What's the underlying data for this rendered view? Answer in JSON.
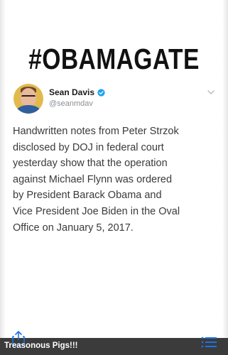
{
  "headline": {
    "hashtag": "#OBAMAGATE"
  },
  "tweet": {
    "display_name": "Sean Davis",
    "handle": "@seanmdav",
    "body": "Handwritten notes from Peter Strzok\ndisclosed by DOJ in federal court\nyesterday show that the operation\nagainst Michael Flynn was ordered\nby President Barack Obama and\nVice President Joe Biden in the Oval\nOffice on January 5, 2017.",
    "icons": {
      "verified": "verified-badge-icon",
      "more": "chevron-down-icon"
    }
  },
  "caption": {
    "text": "Treasonous Pigs!!!"
  },
  "toolbar": {
    "share_icon": "share-icon",
    "list_icon": "list-icon"
  },
  "colors": {
    "verified_blue": "#1da1f2",
    "caption_bg": "#3b3b3b",
    "list_icon_blue": "#1a73e8"
  }
}
